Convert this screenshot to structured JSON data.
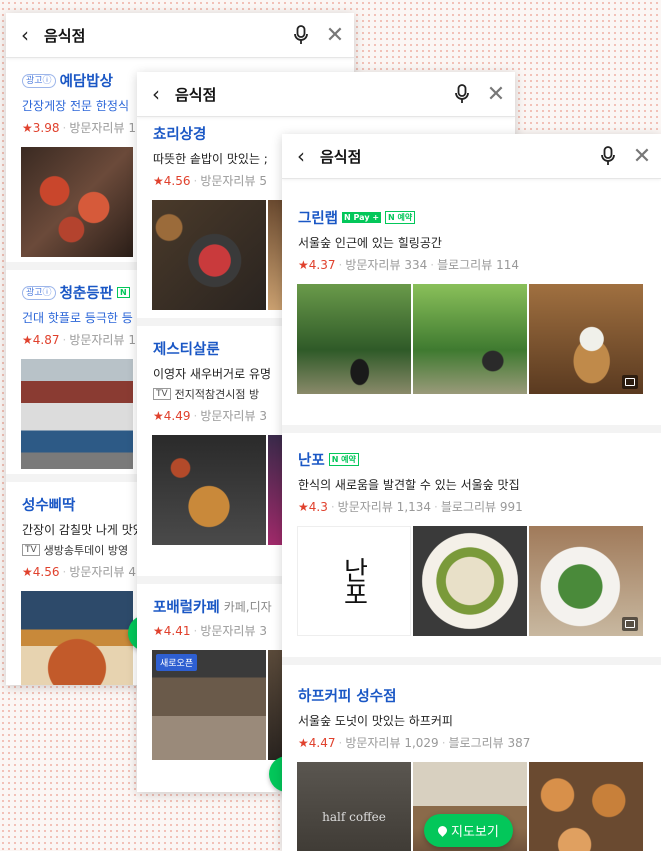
{
  "search": {
    "query": "음식점"
  },
  "card1": {
    "listings": [
      {
        "ad": "광고ⓘ",
        "title": "예담밥상",
        "desc": "간장게장 전문 한정식",
        "rating": "★3.98",
        "reviews": "방문자리뷰 1"
      },
      {
        "ad": "광고ⓘ",
        "title": "청춘등판",
        "badge": "N",
        "desc": "건대 핫플로 등극한 등",
        "rating": "★4.87",
        "reviews": "방문자리뷰 1"
      },
      {
        "title": "성수삐딱",
        "desc": "간장이 감칠맛 나게 맛있",
        "tv": "TV",
        "tvtext": "생방송투데이 방영",
        "rating": "★4.56",
        "reviews": "방문자리뷰 4"
      }
    ]
  },
  "card2": {
    "listings": [
      {
        "title": "쵸리상경",
        "desc": "따뜻한 솥밥이 맛있는 ;",
        "rating": "★4.56",
        "reviews": "방문자리뷰 5"
      },
      {
        "title": "제스티살룬",
        "desc": "이영자 새우버거로 유명",
        "tv": "TV",
        "tvtext": "전지적참견시점 방",
        "rating": "★4.49",
        "reviews": "방문자리뷰 3"
      },
      {
        "title": "포배럴카페",
        "subcat": "카페,디자",
        "rating": "★4.41",
        "reviews": "방문자리뷰 3",
        "new_badge": "새로오픈"
      }
    ]
  },
  "card3": {
    "listings": [
      {
        "title": "그린랩",
        "npay": "N Pay +",
        "nres": "N 예약",
        "desc": "서울숲 인근에 있는 힐링공간",
        "rating": "★4.37",
        "reviews": "방문자리뷰 334",
        "blog": "블로그리뷰 114"
      },
      {
        "title": "난포",
        "nres": "N 예약",
        "desc": "한식의 새로움을 발견할 수 있는 서울숲 맛집",
        "rating": "★4.3",
        "reviews": "방문자리뷰 1,134",
        "blog": "블로그리뷰 991"
      },
      {
        "title": "하프커피 성수점",
        "desc": "서울숲 도넛이 맛있는 하프커피",
        "rating": "★4.47",
        "reviews": "방문자리뷰 1,029",
        "blog": "블로그리뷰 387"
      }
    ],
    "map_button": "지도보기",
    "logo_text_1": "난포",
    "logo_text_2": "half coffee"
  },
  "colors": {
    "accent_green": "#03c75a",
    "title_blue": "#1a57c5",
    "star_red": "#e0412d"
  }
}
